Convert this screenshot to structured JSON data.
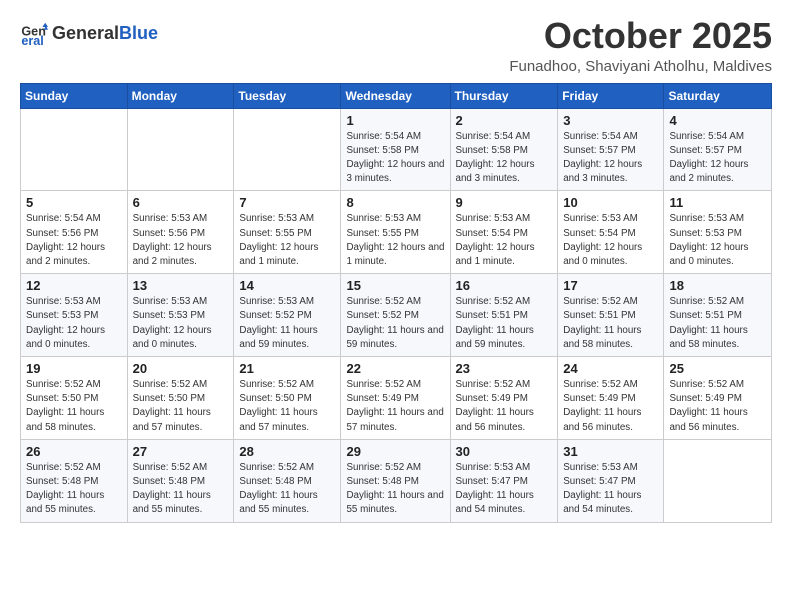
{
  "header": {
    "logo_general": "General",
    "logo_blue": "Blue",
    "month_title": "October 2025",
    "location": "Funadhoo, Shaviyani Atholhu, Maldives"
  },
  "days_of_week": [
    "Sunday",
    "Monday",
    "Tuesday",
    "Wednesday",
    "Thursday",
    "Friday",
    "Saturday"
  ],
  "weeks": [
    [
      {
        "day": "",
        "info": ""
      },
      {
        "day": "",
        "info": ""
      },
      {
        "day": "",
        "info": ""
      },
      {
        "day": "1",
        "info": "Sunrise: 5:54 AM\nSunset: 5:58 PM\nDaylight: 12 hours\nand 3 minutes."
      },
      {
        "day": "2",
        "info": "Sunrise: 5:54 AM\nSunset: 5:58 PM\nDaylight: 12 hours\nand 3 minutes."
      },
      {
        "day": "3",
        "info": "Sunrise: 5:54 AM\nSunset: 5:57 PM\nDaylight: 12 hours\nand 3 minutes."
      },
      {
        "day": "4",
        "info": "Sunrise: 5:54 AM\nSunset: 5:57 PM\nDaylight: 12 hours\nand 2 minutes."
      }
    ],
    [
      {
        "day": "5",
        "info": "Sunrise: 5:54 AM\nSunset: 5:56 PM\nDaylight: 12 hours\nand 2 minutes."
      },
      {
        "day": "6",
        "info": "Sunrise: 5:53 AM\nSunset: 5:56 PM\nDaylight: 12 hours\nand 2 minutes."
      },
      {
        "day": "7",
        "info": "Sunrise: 5:53 AM\nSunset: 5:55 PM\nDaylight: 12 hours\nand 1 minute."
      },
      {
        "day": "8",
        "info": "Sunrise: 5:53 AM\nSunset: 5:55 PM\nDaylight: 12 hours\nand 1 minute."
      },
      {
        "day": "9",
        "info": "Sunrise: 5:53 AM\nSunset: 5:54 PM\nDaylight: 12 hours\nand 1 minute."
      },
      {
        "day": "10",
        "info": "Sunrise: 5:53 AM\nSunset: 5:54 PM\nDaylight: 12 hours\nand 0 minutes."
      },
      {
        "day": "11",
        "info": "Sunrise: 5:53 AM\nSunset: 5:53 PM\nDaylight: 12 hours\nand 0 minutes."
      }
    ],
    [
      {
        "day": "12",
        "info": "Sunrise: 5:53 AM\nSunset: 5:53 PM\nDaylight: 12 hours\nand 0 minutes."
      },
      {
        "day": "13",
        "info": "Sunrise: 5:53 AM\nSunset: 5:53 PM\nDaylight: 12 hours\nand 0 minutes."
      },
      {
        "day": "14",
        "info": "Sunrise: 5:53 AM\nSunset: 5:52 PM\nDaylight: 11 hours\nand 59 minutes."
      },
      {
        "day": "15",
        "info": "Sunrise: 5:52 AM\nSunset: 5:52 PM\nDaylight: 11 hours\nand 59 minutes."
      },
      {
        "day": "16",
        "info": "Sunrise: 5:52 AM\nSunset: 5:51 PM\nDaylight: 11 hours\nand 59 minutes."
      },
      {
        "day": "17",
        "info": "Sunrise: 5:52 AM\nSunset: 5:51 PM\nDaylight: 11 hours\nand 58 minutes."
      },
      {
        "day": "18",
        "info": "Sunrise: 5:52 AM\nSunset: 5:51 PM\nDaylight: 11 hours\nand 58 minutes."
      }
    ],
    [
      {
        "day": "19",
        "info": "Sunrise: 5:52 AM\nSunset: 5:50 PM\nDaylight: 11 hours\nand 58 minutes."
      },
      {
        "day": "20",
        "info": "Sunrise: 5:52 AM\nSunset: 5:50 PM\nDaylight: 11 hours\nand 57 minutes."
      },
      {
        "day": "21",
        "info": "Sunrise: 5:52 AM\nSunset: 5:50 PM\nDaylight: 11 hours\nand 57 minutes."
      },
      {
        "day": "22",
        "info": "Sunrise: 5:52 AM\nSunset: 5:49 PM\nDaylight: 11 hours\nand 57 minutes."
      },
      {
        "day": "23",
        "info": "Sunrise: 5:52 AM\nSunset: 5:49 PM\nDaylight: 11 hours\nand 56 minutes."
      },
      {
        "day": "24",
        "info": "Sunrise: 5:52 AM\nSunset: 5:49 PM\nDaylight: 11 hours\nand 56 minutes."
      },
      {
        "day": "25",
        "info": "Sunrise: 5:52 AM\nSunset: 5:49 PM\nDaylight: 11 hours\nand 56 minutes."
      }
    ],
    [
      {
        "day": "26",
        "info": "Sunrise: 5:52 AM\nSunset: 5:48 PM\nDaylight: 11 hours\nand 55 minutes."
      },
      {
        "day": "27",
        "info": "Sunrise: 5:52 AM\nSunset: 5:48 PM\nDaylight: 11 hours\nand 55 minutes."
      },
      {
        "day": "28",
        "info": "Sunrise: 5:52 AM\nSunset: 5:48 PM\nDaylight: 11 hours\nand 55 minutes."
      },
      {
        "day": "29",
        "info": "Sunrise: 5:52 AM\nSunset: 5:48 PM\nDaylight: 11 hours\nand 55 minutes."
      },
      {
        "day": "30",
        "info": "Sunrise: 5:53 AM\nSunset: 5:47 PM\nDaylight: 11 hours\nand 54 minutes."
      },
      {
        "day": "31",
        "info": "Sunrise: 5:53 AM\nSunset: 5:47 PM\nDaylight: 11 hours\nand 54 minutes."
      },
      {
        "day": "",
        "info": ""
      }
    ]
  ]
}
